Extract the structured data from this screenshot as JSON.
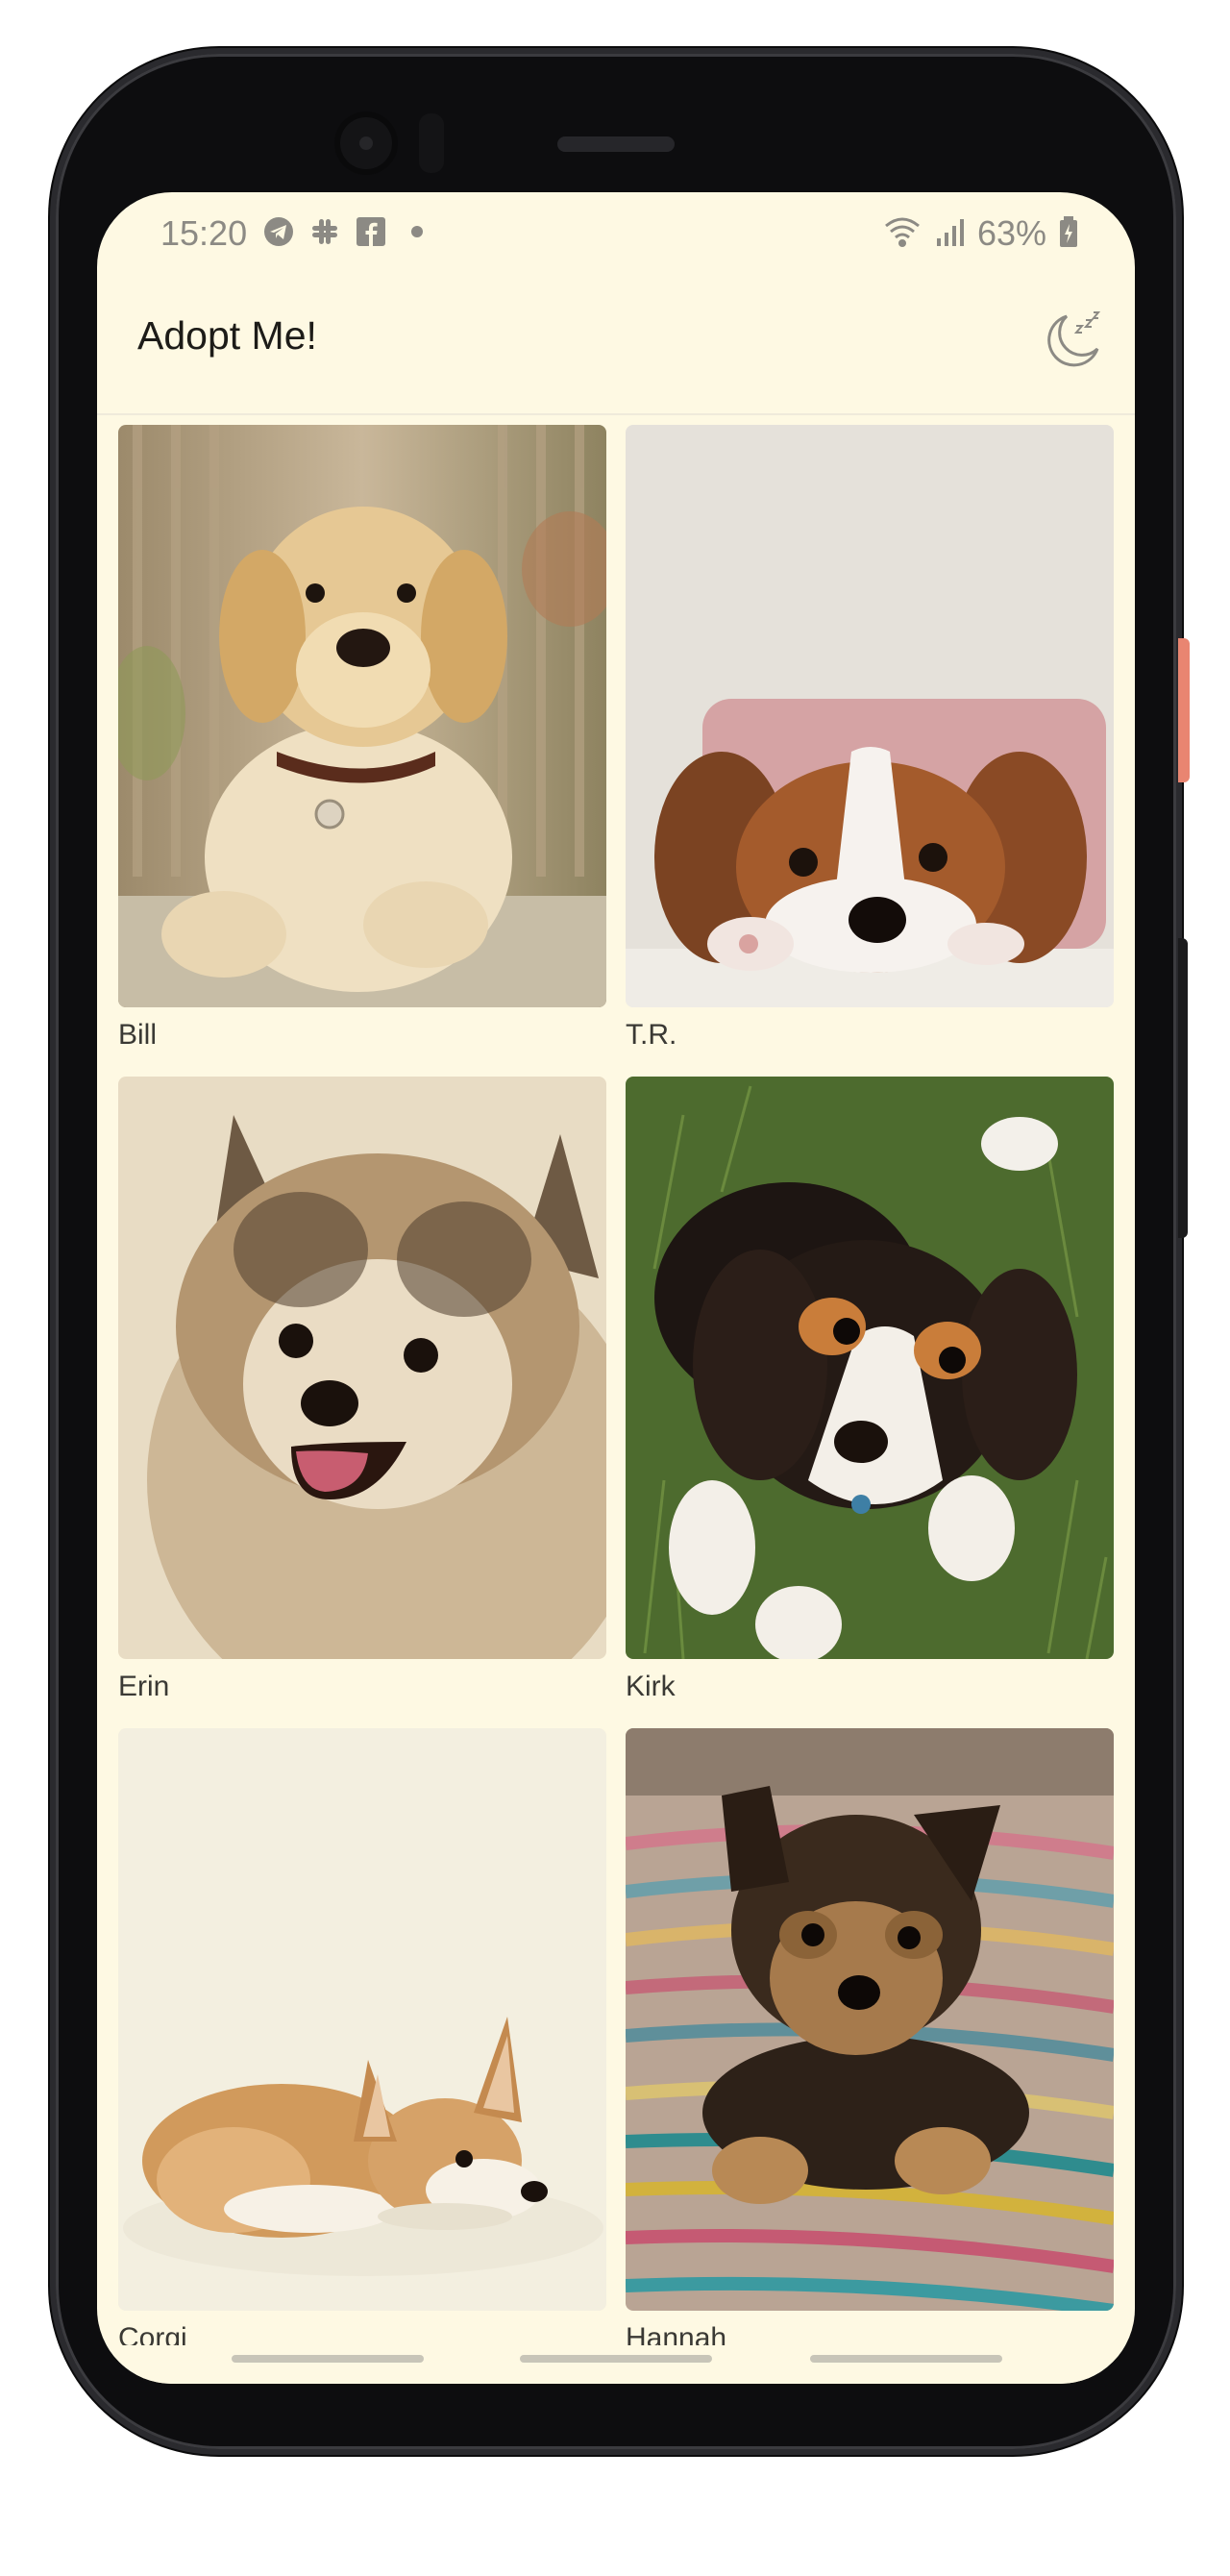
{
  "status_bar": {
    "time": "15:20",
    "notification_icons": [
      "telegram-icon",
      "slack-icon",
      "facebook-icon",
      "dot-icon"
    ],
    "battery": "63%"
  },
  "app_bar": {
    "title": "Adopt Me!",
    "theme_toggle_icon": "moon-sleep-icon"
  },
  "pets": [
    {
      "name": "Bill",
      "photo": "golden-retriever-puppy"
    },
    {
      "name": "T.R.",
      "photo": "cavalier-puppy-on-pillow"
    },
    {
      "name": "Erin",
      "photo": "pomeranian-puppy"
    },
    {
      "name": "Kirk",
      "photo": "tricolor-puppy-in-grass"
    },
    {
      "name": "Corgi",
      "photo": "corgi-puppy-lying"
    },
    {
      "name": "Hannah",
      "photo": "yorkie-puppy-on-rug"
    }
  ],
  "colors": {
    "background": "#fef9e3",
    "title_text": "#1d1c18",
    "label_text": "#3a3934"
  }
}
